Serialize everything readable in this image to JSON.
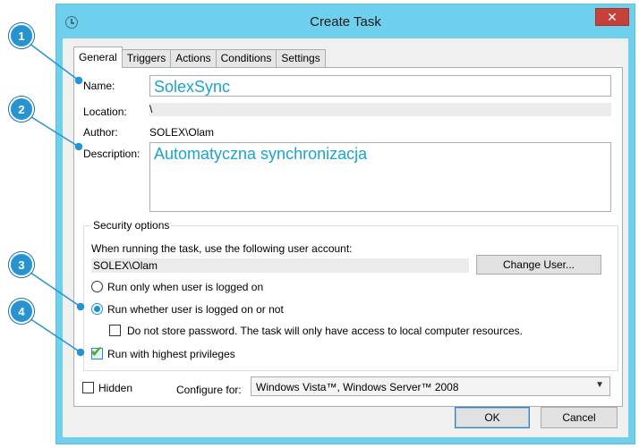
{
  "window": {
    "title": "Create Task",
    "close_label": "✕"
  },
  "tabs": [
    {
      "label": "General",
      "active": true
    },
    {
      "label": "Triggers"
    },
    {
      "label": "Actions"
    },
    {
      "label": "Conditions"
    },
    {
      "label": "Settings"
    }
  ],
  "general": {
    "name_label": "Name:",
    "name_value": "SolexSync",
    "location_label": "Location:",
    "location_value": "\\",
    "author_label": "Author:",
    "author_value": "SOLEX\\Olam",
    "description_label": "Description:",
    "description_value": "Automatyczna synchronizacja"
  },
  "security": {
    "group_title": "Security options",
    "account_prompt": "When running the task, use the following user account:",
    "account_value": "SOLEX\\Olam",
    "change_user_label": "Change User...",
    "radio_logged_on": "Run only when user is logged on",
    "radio_whether": "Run whether user is logged on or not",
    "no_store_password": "Do not store password.  The task will only have access to local computer resources.",
    "highest_privileges": "Run with highest privileges"
  },
  "footer": {
    "hidden_label": "Hidden",
    "configure_label": "Configure for:",
    "configure_value": "Windows Vista™, Windows Server™ 2008",
    "ok_label": "OK",
    "cancel_label": "Cancel"
  },
  "callouts": [
    "1",
    "2",
    "3",
    "4"
  ],
  "colors": {
    "frame": "#6fd0ee",
    "accent_text": "#1aa3d6",
    "callout": "#2793d1",
    "close": "#c7413b"
  }
}
